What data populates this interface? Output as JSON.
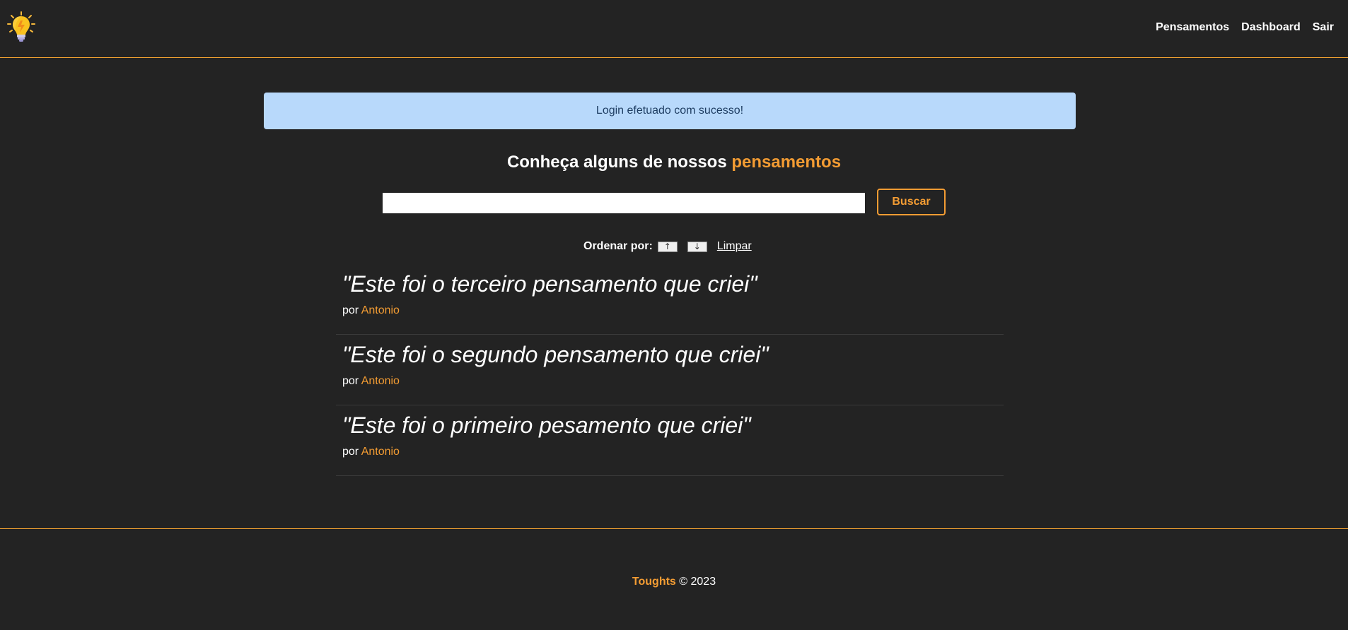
{
  "nav": {
    "items": [
      {
        "label": "Pensamentos"
      },
      {
        "label": "Dashboard"
      },
      {
        "label": "Sair"
      }
    ]
  },
  "flash": {
    "message": "Login efetuado com sucesso!"
  },
  "heading": {
    "prefix": "Conheça alguns de nossos",
    "highlight": "pensamentos"
  },
  "search": {
    "value": "",
    "placeholder": "",
    "button_label": "Buscar"
  },
  "order": {
    "label": "Ordenar por:",
    "asc_label": "↑",
    "desc_label": "↓",
    "clear_label": "Limpar"
  },
  "thoughts": [
    {
      "text": "\"Este foi o terceiro pensamento que criei\"",
      "by": "por",
      "author": "Antonio"
    },
    {
      "text": "\"Este foi o segundo pensamento que criei\"",
      "by": "por",
      "author": "Antonio"
    },
    {
      "text": "\"Este foi o primeiro pesamento que criei\"",
      "by": "por",
      "author": "Antonio"
    }
  ],
  "footer": {
    "brand": "Toughts",
    "copyright": "© 2023"
  },
  "colors": {
    "background": "#232323",
    "accent": "#f39c33",
    "flash_bg": "#b8d9fb",
    "flash_text": "#1e3d62"
  },
  "icons": {
    "logo": "lightbulb-icon"
  }
}
